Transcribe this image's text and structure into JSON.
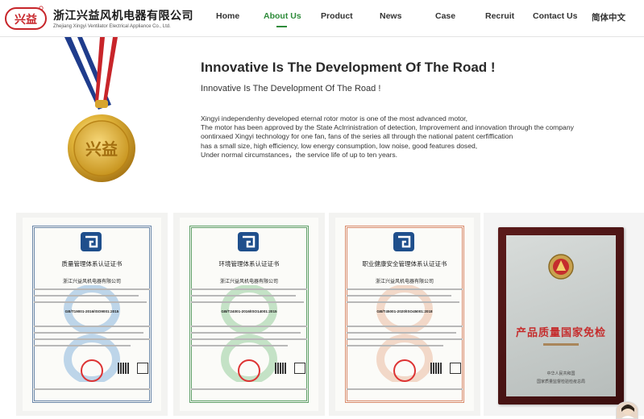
{
  "header": {
    "company_cn": "浙江兴益风机电器有限公司",
    "company_en": "Zhejiang Xingyi Ventilator Electrical Appliance Co., Ltd.",
    "logo_icon": "company-logo-icon"
  },
  "nav": {
    "items": [
      {
        "label": "Home",
        "active": false
      },
      {
        "label": "About Us",
        "active": true
      },
      {
        "label": "Product",
        "active": false
      },
      {
        "label": "News",
        "active": false
      },
      {
        "label": "Case",
        "active": false
      },
      {
        "label": "Recruit",
        "active": false
      },
      {
        "label": "Contact Us",
        "active": false
      },
      {
        "label": "简体中文",
        "active": false
      }
    ],
    "active_color": "#2e8b3a"
  },
  "hero": {
    "title": "Innovative Is The Development Of The Road !",
    "subtitle": "Innovative Is The Development Of The Road !",
    "body": [
      "Xingyi independenhy developed eternal rotor motor is one of the most advanced motor,",
      "The motor has been approved by the State Aclrrinistration of detection, Improvement and innovation through the company",
      "oontirxaed Xingyi technology for one fan, fans of the series all through the national patent cerfiffication",
      "has a small size, high efficiency, low energy consumption, low noise, good features dosed,",
      "Under normal circumstances，the service life of up to ten years."
    ]
  },
  "certificates": [
    {
      "title": "质量管理体系认证证书",
      "company": "浙江兴益风机电器有限公司",
      "standard": "GB/T19001-2016/ISO9001:2015",
      "border_color": "#6a86a8"
    },
    {
      "title": "环境管理体系认证证书",
      "company": "浙江兴益风机电器有限公司",
      "standard": "GB/T24001-2016/ISO14001:2015",
      "border_color": "#5e9f67"
    },
    {
      "title": "职业健康安全管理体系认证证书",
      "company": "浙江兴益风机电器有限公司",
      "standard": "GB/T45001-2020/ISO45001:2018",
      "border_color": "#d98a6a"
    }
  ],
  "award": {
    "title": "产品质量国家免检",
    "issuer_line1": "中华人民共和国",
    "issuer_line2": "国家质量监督检验检疫总局"
  }
}
